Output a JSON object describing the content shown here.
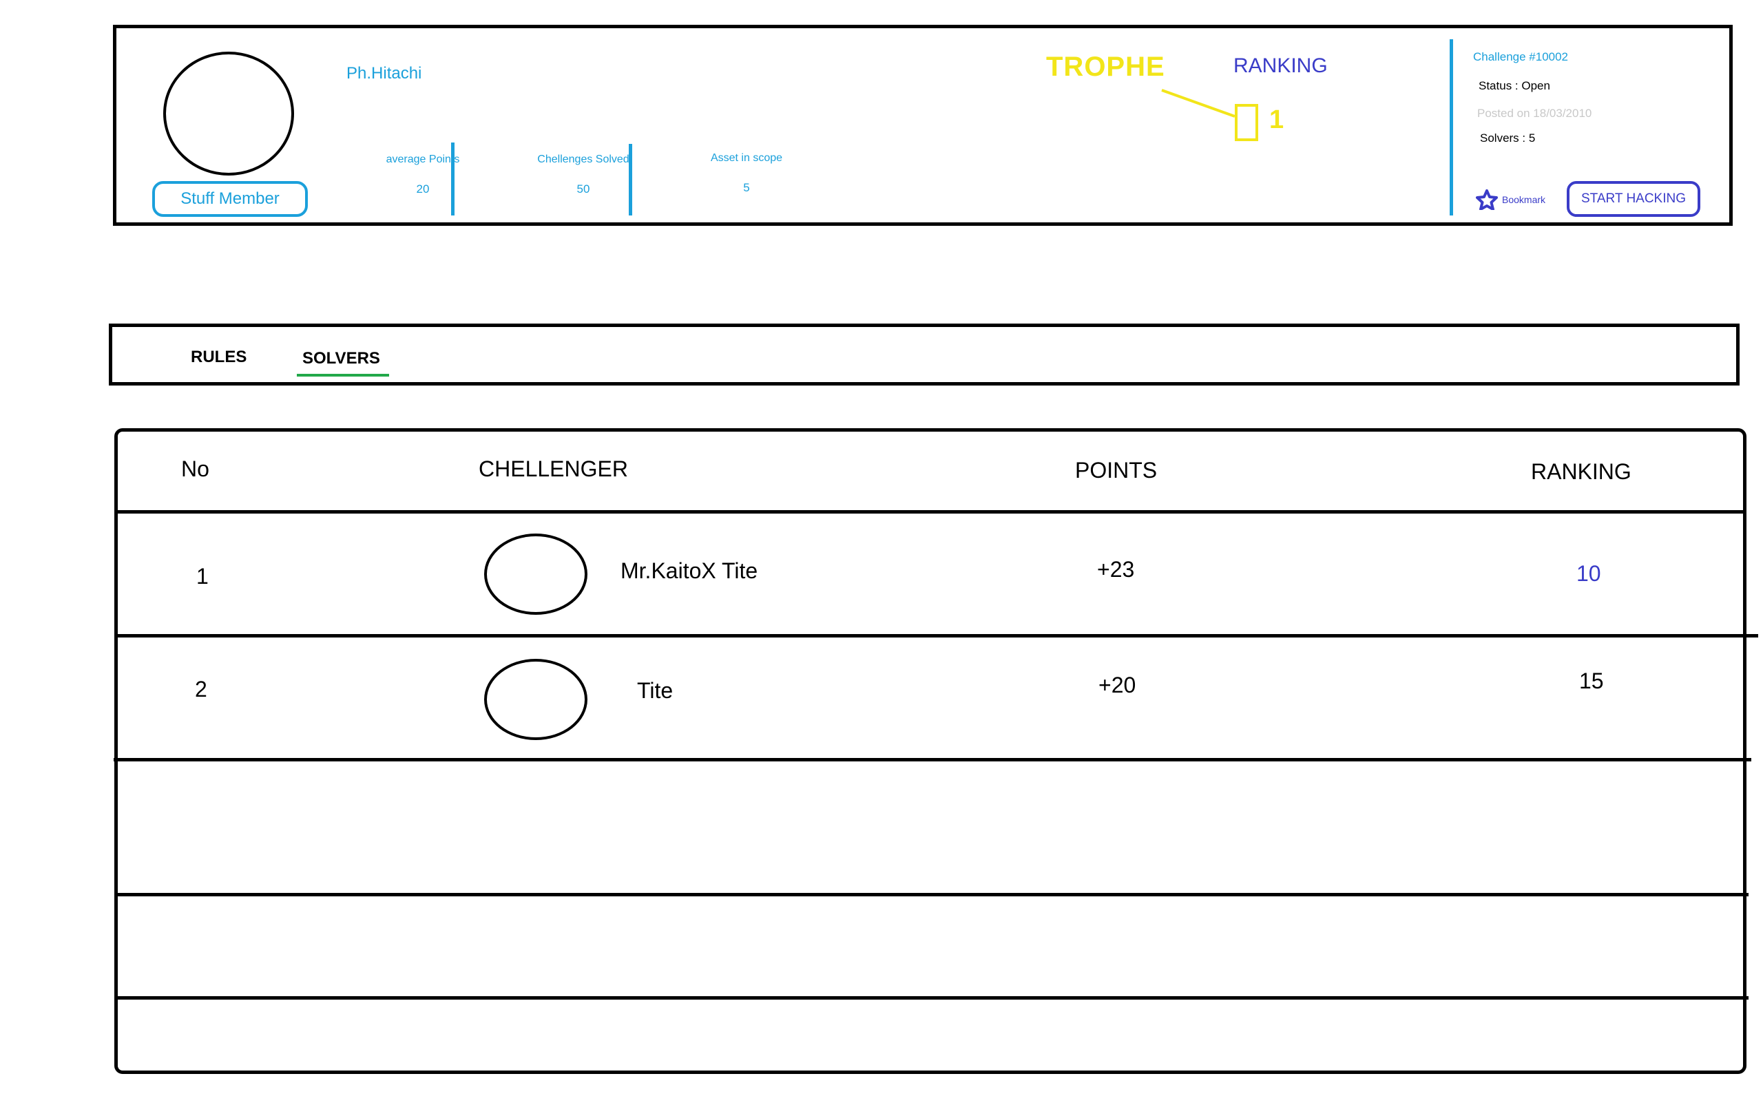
{
  "profile": {
    "username": "Ph.Hitachi",
    "member_badge": "Stuff Member",
    "stats": [
      {
        "label": "average Points",
        "value": "20"
      },
      {
        "label": "Chellenges Solved",
        "value": "50"
      },
      {
        "label": "Asset in scope",
        "value": "5"
      }
    ],
    "trophy_title": "TROPHE",
    "ranking_title": "RANKING",
    "trophy_count": "1"
  },
  "challenge": {
    "id": "Challenge #10002",
    "status": "Status : Open",
    "posted": "Posted on 18/03/2010",
    "solvers": "Solvers : 5",
    "bookmark_label": "Bookmark",
    "start_label": "START HACKING"
  },
  "tabs": [
    {
      "label": "RULES",
      "active": false
    },
    {
      "label": "SOLVERS",
      "active": true
    }
  ],
  "table": {
    "headers": [
      "No",
      "CHELLENGER",
      "POINTS",
      "RANKING"
    ],
    "rows": [
      {
        "no": "1",
        "name": "Mr.KaitoX Tite",
        "points": "+23",
        "ranking": "10"
      },
      {
        "no": "2",
        "name": "Tite",
        "points": "+20",
        "ranking": "15"
      }
    ]
  },
  "colors": {
    "accent_cyan": "#1ba0db",
    "accent_blue": "#3a3cc8",
    "trophy_yellow": "#f2e51a",
    "tab_active_underline": "#22a84a"
  },
  "icons": {
    "bookmark": "star-icon"
  }
}
